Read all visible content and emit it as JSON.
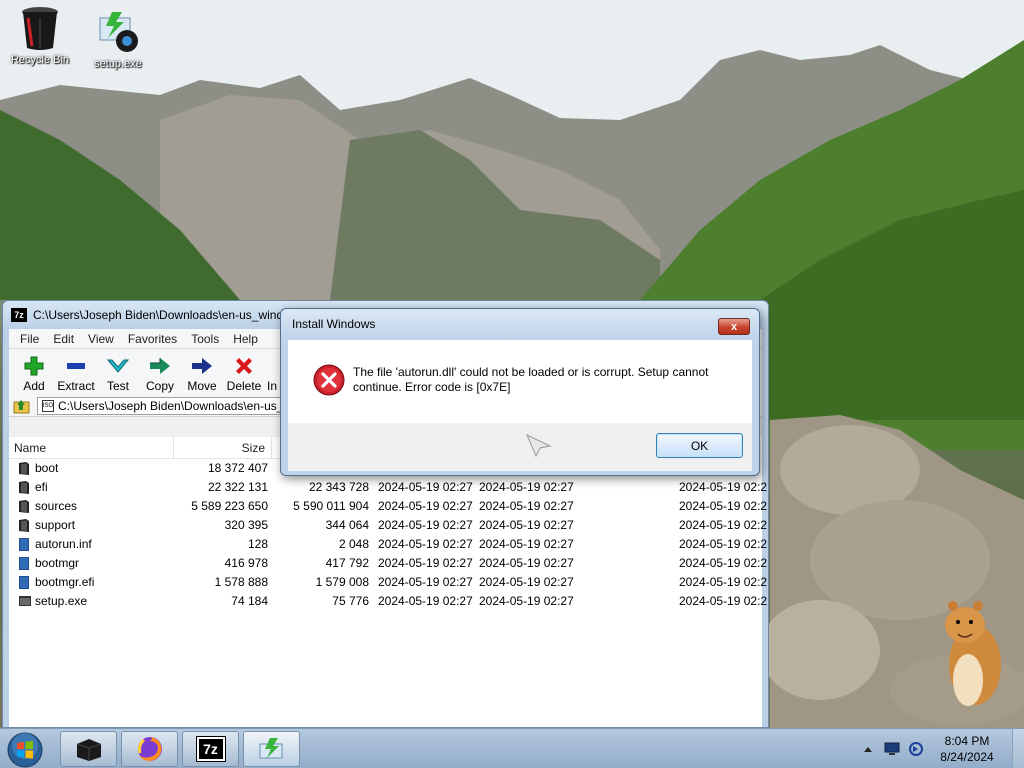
{
  "desktop": {
    "icons": [
      {
        "label": "Recycle Bin",
        "icon": "recycle-bin-icon"
      },
      {
        "label": "setup.exe",
        "icon": "setup-exe-icon"
      }
    ]
  },
  "zip_window": {
    "title": "C:\\Users\\Joseph Biden\\Downloads\\en-us_windows",
    "app_icon_text": "7z",
    "menu": [
      "File",
      "Edit",
      "View",
      "Favorites",
      "Tools",
      "Help"
    ],
    "toolbar": [
      {
        "label": "Add",
        "icon": "add-plus-icon",
        "color": "#22a628"
      },
      {
        "label": "Extract",
        "icon": "extract-minus-icon",
        "color": "#1c3fb0"
      },
      {
        "label": "Test",
        "icon": "test-check-icon",
        "color": "#1fa0b8"
      },
      {
        "label": "Copy",
        "icon": "copy-arrow-icon",
        "color": "#1b8a5a"
      },
      {
        "label": "Move",
        "icon": "move-arrow-icon",
        "color": "#1c2f8a"
      },
      {
        "label": "Delete",
        "icon": "delete-x-icon",
        "color": "#d8181b"
      },
      {
        "label": "In",
        "icon": "info-icon",
        "color": "#1c3fb0"
      }
    ],
    "address": "C:\\Users\\Joseph Biden\\Downloads\\en-us_",
    "address_icon_text": "ISO",
    "columns": {
      "name": "Name",
      "size": "Size"
    },
    "files": [
      {
        "name": "boot",
        "type": "folder",
        "size": "18 372 407",
        "packed": "",
        "modified": "",
        "created": "",
        "accessed": ""
      },
      {
        "name": "efi",
        "type": "folder",
        "size": "22 322 131",
        "packed": "22 343 728",
        "modified": "2024-05-19 02:27",
        "created": "2024-05-19 02:27",
        "accessed": "2024-05-19 02:2"
      },
      {
        "name": "sources",
        "type": "folder",
        "size": "5 589 223 650",
        "packed": "5 590 011 904",
        "modified": "2024-05-19 02:27",
        "created": "2024-05-19 02:27",
        "accessed": "2024-05-19 02:2"
      },
      {
        "name": "support",
        "type": "folder",
        "size": "320 395",
        "packed": "344 064",
        "modified": "2024-05-19 02:27",
        "created": "2024-05-19 02:27",
        "accessed": "2024-05-19 02:2"
      },
      {
        "name": "autorun.inf",
        "type": "file",
        "size": "128",
        "packed": "2 048",
        "modified": "2024-05-19 02:27",
        "created": "2024-05-19 02:27",
        "accessed": "2024-05-19 02:2"
      },
      {
        "name": "bootmgr",
        "type": "file",
        "size": "416 978",
        "packed": "417 792",
        "modified": "2024-05-19 02:27",
        "created": "2024-05-19 02:27",
        "accessed": "2024-05-19 02:2"
      },
      {
        "name": "bootmgr.efi",
        "type": "file",
        "size": "1 578 888",
        "packed": "1 579 008",
        "modified": "2024-05-19 02:27",
        "created": "2024-05-19 02:27",
        "accessed": "2024-05-19 02:2"
      },
      {
        "name": "setup.exe",
        "type": "exe",
        "size": "74 184",
        "packed": "75 776",
        "modified": "2024-05-19 02:27",
        "created": "2024-05-19 02:27",
        "accessed": "2024-05-19 02:2"
      }
    ]
  },
  "dialog": {
    "title": "Install Windows",
    "close": "x",
    "message": "The file 'autorun.dll' could not be loaded or is corrupt. Setup cannot continue. Error code is [0x7E]",
    "ok": "OK",
    "icon": "error-icon",
    "error_color": "#c8202a"
  },
  "taskbar": {
    "apps": [
      {
        "name": "explorer",
        "icon": "black-box-icon"
      },
      {
        "name": "firefox",
        "icon": "firefox-icon"
      },
      {
        "name": "7zip",
        "icon": "7zip-icon",
        "text": "7z"
      },
      {
        "name": "setup",
        "icon": "setup-icon"
      }
    ],
    "clock_time": "8:04 PM",
    "clock_date": "8/24/2024"
  }
}
